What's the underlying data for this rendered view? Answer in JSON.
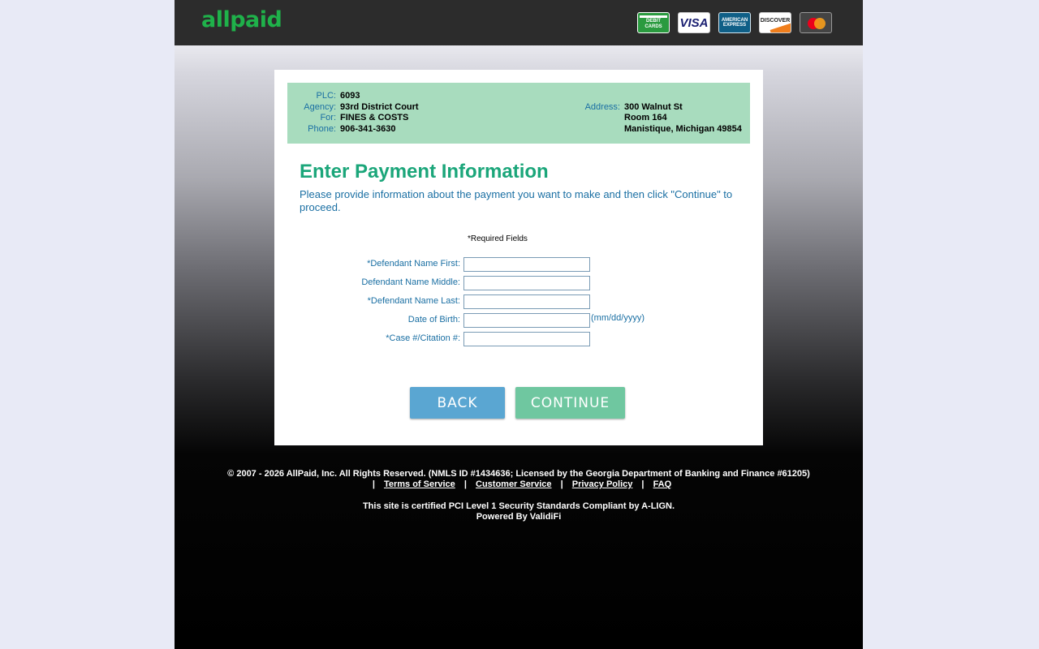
{
  "brand": {
    "logo_text": "allpaid",
    "logo_color": "#1fb14a"
  },
  "header": {
    "cards": [
      {
        "name": "debit-card-icon",
        "label": "DEBIT CARDS"
      },
      {
        "name": "visa-card-icon",
        "label": "VISA"
      },
      {
        "name": "amex-card-icon",
        "label": "AMERICAN EXPRESS"
      },
      {
        "name": "discover-card-icon",
        "label": "DISCOVER"
      },
      {
        "name": "mastercard-card-icon",
        "label": ""
      }
    ]
  },
  "info": {
    "plc_label": "PLC:",
    "plc_value": "6093",
    "agency_label": "Agency:",
    "agency_value": "93rd District Court",
    "for_label": "For:",
    "for_value": "FINES & COSTS",
    "phone_label": "Phone:",
    "phone_value": "906-341-3630",
    "address_label": "Address:",
    "address_line1": "300 Walnut St",
    "address_line2": "Room 164",
    "address_line3": "Manistique, Michigan 49854"
  },
  "form": {
    "title": "Enter Payment Information",
    "instructions": "Please provide information about the payment you want to make and then click \"Continue\" to proceed.",
    "required_note": "*Required Fields",
    "fields": {
      "first_name": {
        "label": "*Defendant Name First:",
        "value": ""
      },
      "middle_name": {
        "label": "Defendant Name Middle:",
        "value": ""
      },
      "last_name": {
        "label": "*Defendant Name Last:",
        "value": ""
      },
      "dob": {
        "label": "Date of Birth:",
        "value": "",
        "hint": "(mm/dd/yyyy)"
      },
      "case_number": {
        "label": "*Case #/Citation #:",
        "value": ""
      }
    },
    "back_label": "BACK",
    "continue_label": "CONTINUE"
  },
  "footer": {
    "copyright": "© 2007 - 2026 AllPaid, Inc. All Rights Reserved. (NMLS ID #1434636; Licensed by the Georgia Department of Banking and Finance #61205)",
    "links": {
      "terms": "Terms of Service",
      "customer_service": "Customer Service",
      "privacy": "Privacy Policy",
      "faq": "FAQ"
    },
    "separator": "|",
    "pci": "This site is certified PCI Level 1 Security Standards Compliant by A-LIGN.",
    "powered_by": "Powered By ValidiFi"
  },
  "colors": {
    "accent_green": "#1ba67a",
    "info_bg": "#a8dcbe",
    "label_blue": "#1a6fa3",
    "back_button": "#5aa6d2",
    "continue_button": "#6fc7a0"
  }
}
